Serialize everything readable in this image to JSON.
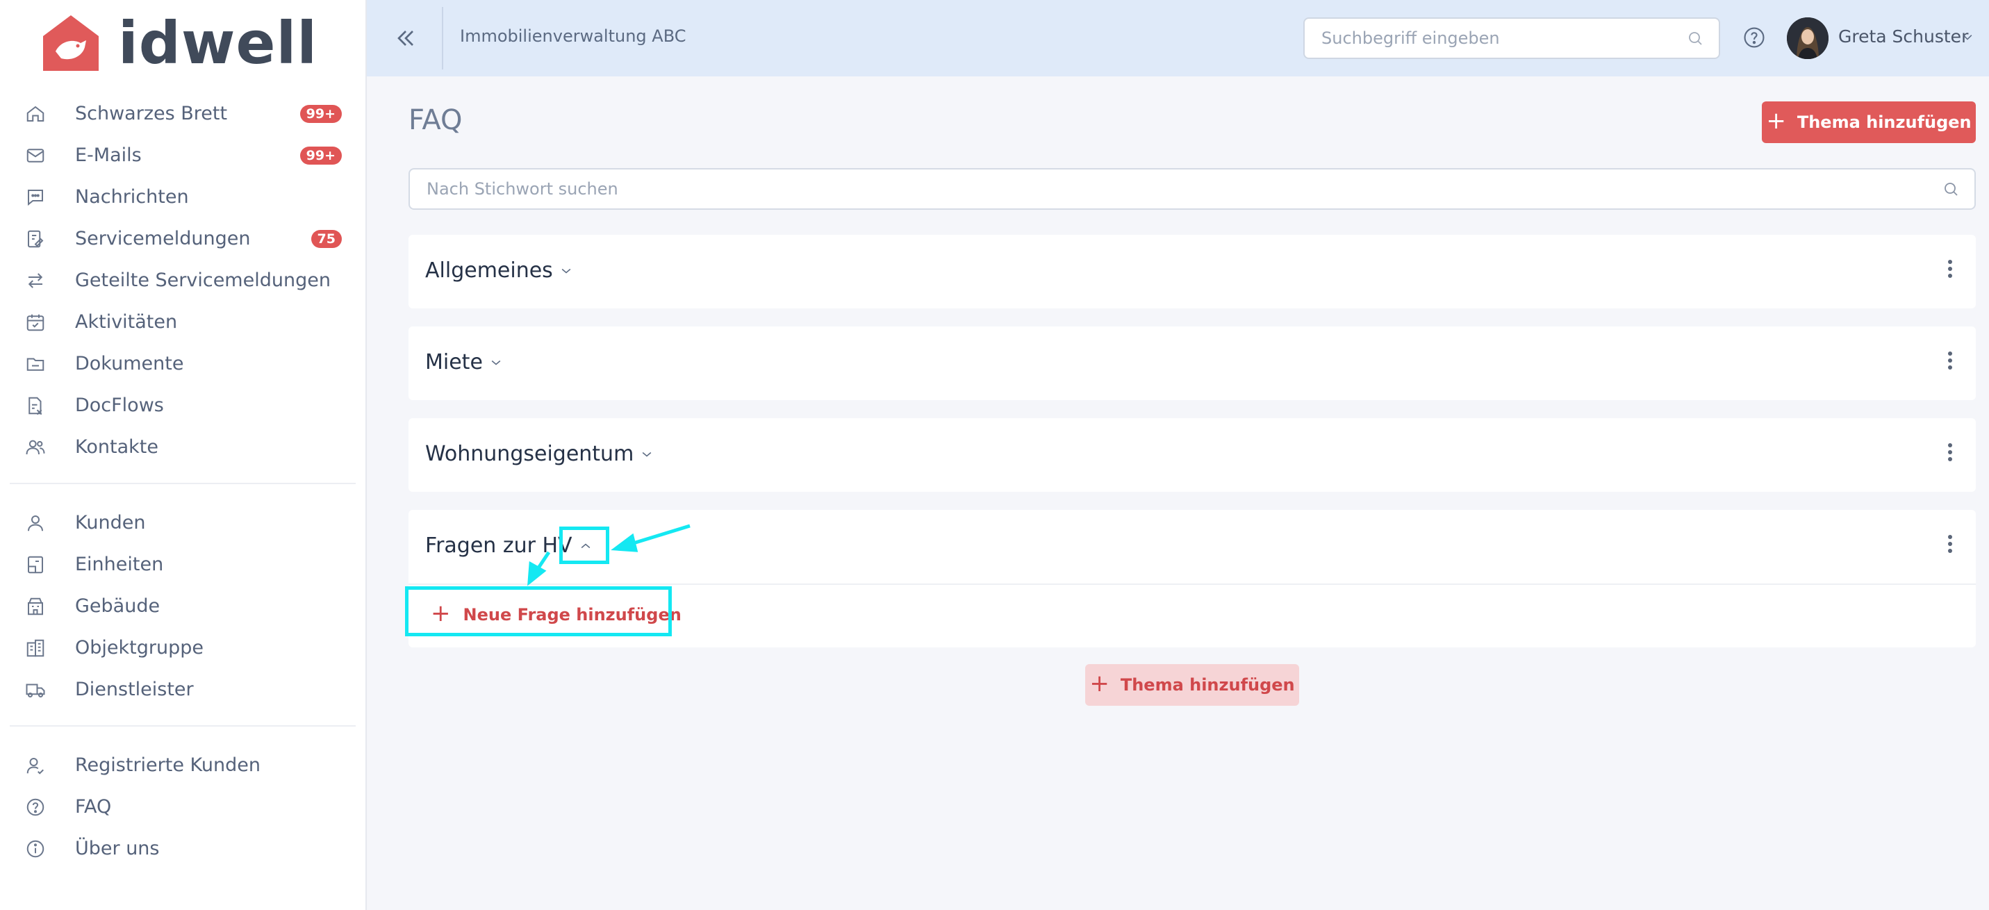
{
  "brand": {
    "name": "idwell",
    "logo_color": "#e05a5a"
  },
  "sidebar": {
    "primary": [
      {
        "label": "Schwarzes Brett",
        "badge": "99+",
        "icon": "home-icon"
      },
      {
        "label": "E-Mails",
        "badge": "99+",
        "icon": "mail-icon"
      },
      {
        "label": "Nachrichten",
        "badge": "",
        "icon": "chat-icon"
      },
      {
        "label": "Servicemeldungen",
        "badge": "75",
        "icon": "service-icon"
      },
      {
        "label": "Geteilte Servicemeldungen",
        "badge": "",
        "icon": "swap-icon"
      },
      {
        "label": "Aktivitäten",
        "badge": "",
        "icon": "calendar-check-icon"
      },
      {
        "label": "Dokumente",
        "badge": "",
        "icon": "folder-icon"
      },
      {
        "label": "DocFlows",
        "badge": "",
        "icon": "docflow-icon"
      },
      {
        "label": "Kontakte",
        "badge": "",
        "icon": "contacts-icon"
      }
    ],
    "secondary": [
      {
        "label": "Kunden",
        "icon": "user-icon"
      },
      {
        "label": "Einheiten",
        "icon": "unit-icon"
      },
      {
        "label": "Gebäude",
        "icon": "building-icon"
      },
      {
        "label": "Objektgruppe",
        "icon": "object-group-icon"
      },
      {
        "label": "Dienstleister",
        "icon": "truck-icon"
      }
    ],
    "tertiary": [
      {
        "label": "Registrierte Kunden",
        "icon": "user-check-icon"
      },
      {
        "label": "FAQ",
        "icon": "help-circle-icon"
      },
      {
        "label": "Über uns",
        "icon": "info-icon"
      }
    ]
  },
  "header": {
    "org_name": "Immobilienverwaltung ABC",
    "search_placeholder": "Suchbegriff eingeben",
    "user_name": "Greta Schuster",
    "bg_color": "#dfeaf9"
  },
  "main": {
    "title": "FAQ",
    "add_topic_label": "Thema hinzufügen",
    "search_placeholder": "Nach Stichwort suchen",
    "topics": [
      {
        "title": "Allgemeines",
        "expanded": false
      },
      {
        "title": "Miete",
        "expanded": false
      },
      {
        "title": "Wohnungseigentum",
        "expanded": false
      },
      {
        "title": "Fragen zur HV",
        "expanded": true,
        "add_question_label": "Neue Frage hinzufügen"
      }
    ],
    "add_topic_bottom_label": "Thema hinzufügen"
  },
  "colors": {
    "accent": "#e05a5a",
    "accent_soft": "#f6d4d6",
    "annotation": "#14e8f2"
  }
}
